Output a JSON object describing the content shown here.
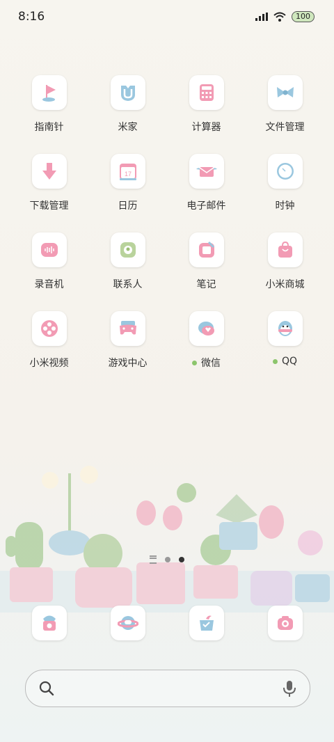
{
  "status": {
    "time": "8:16",
    "battery": "100"
  },
  "apps": [
    {
      "label": "指南针",
      "icon": "compass-flag-icon"
    },
    {
      "label": "米家",
      "icon": "mijia-icon"
    },
    {
      "label": "计算器",
      "icon": "calculator-icon"
    },
    {
      "label": "文件管理",
      "icon": "bow-folder-icon"
    },
    {
      "label": "下载管理",
      "icon": "download-arrow-icon"
    },
    {
      "label": "日历",
      "icon": "calendar-icon",
      "badge": "17"
    },
    {
      "label": "电子邮件",
      "icon": "envelope-icon"
    },
    {
      "label": "时钟",
      "icon": "clock-icon"
    },
    {
      "label": "录音机",
      "icon": "recorder-icon"
    },
    {
      "label": "联系人",
      "icon": "contacts-icon"
    },
    {
      "label": "笔记",
      "icon": "notes-icon"
    },
    {
      "label": "小米商城",
      "icon": "shopping-bag-icon"
    },
    {
      "label": "小米视频",
      "icon": "video-reel-icon"
    },
    {
      "label": "游戏中心",
      "icon": "gamepad-icon"
    },
    {
      "label": "微信",
      "icon": "wechat-icon",
      "dot": true
    },
    {
      "label": "QQ",
      "icon": "qq-penguin-icon",
      "dot": true
    }
  ],
  "dock": [
    {
      "icon": "phone-icon"
    },
    {
      "icon": "message-planet-icon"
    },
    {
      "icon": "browser-box-icon"
    },
    {
      "icon": "camera-icon"
    }
  ],
  "colors": {
    "pink": "#f29bb4",
    "blue": "#9ac7df",
    "green": "#8cc56c"
  }
}
